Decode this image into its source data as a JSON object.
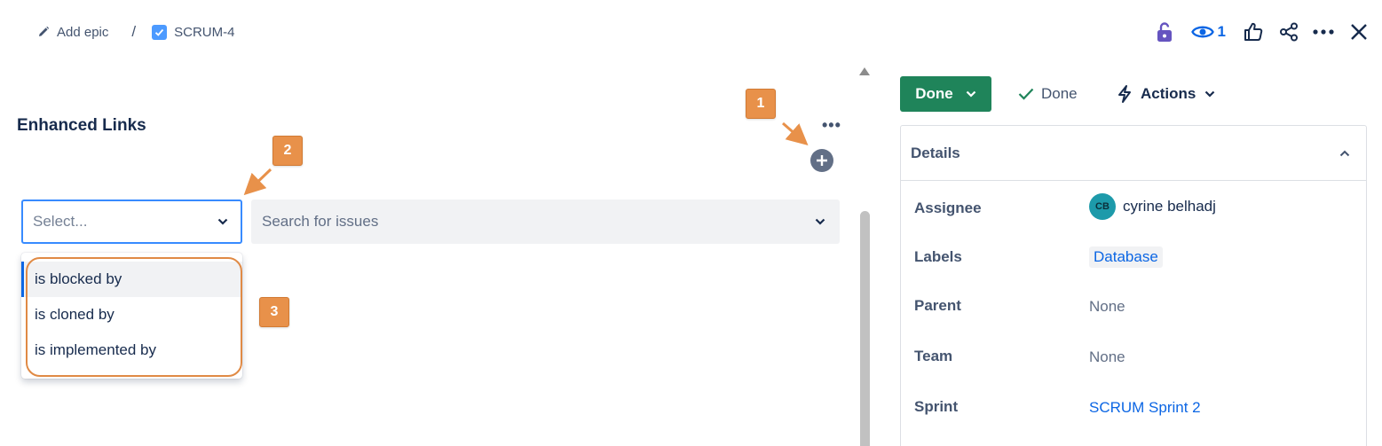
{
  "breadcrumb": {
    "add_epic": "Add epic",
    "separator": "/",
    "issue_key": "SCRUM-4"
  },
  "toolbar": {
    "watch_count": "1",
    "icons": [
      "lock-open-icon",
      "eye-icon",
      "thumbs-up-icon",
      "share-icon",
      "more-icon",
      "close-icon"
    ]
  },
  "panel": {
    "title": "Enhanced Links",
    "more": "•••"
  },
  "link_form": {
    "select_placeholder": "Select...",
    "search_placeholder": "Search for issues",
    "options": [
      "is blocked by",
      "is cloned by",
      "is implemented by"
    ],
    "highlighted_option": "is blocked by"
  },
  "annotations": [
    "1",
    "2",
    "3"
  ],
  "status": {
    "button_label": "Done",
    "resolution": "Done",
    "actions_label": "Actions"
  },
  "details": {
    "title": "Details",
    "fields": [
      {
        "label": "Assignee",
        "value": "cyrine belhadj",
        "avatar": "CB"
      },
      {
        "label": "Labels",
        "value": "Database"
      },
      {
        "label": "Parent",
        "value": "None"
      },
      {
        "label": "Team",
        "value": "None"
      },
      {
        "label": "Sprint",
        "value": "SCRUM Sprint 2"
      }
    ]
  },
  "colors": {
    "done_green": "#1f845a",
    "link_blue": "#0c66e4",
    "annotation_orange": "#e8914a"
  }
}
